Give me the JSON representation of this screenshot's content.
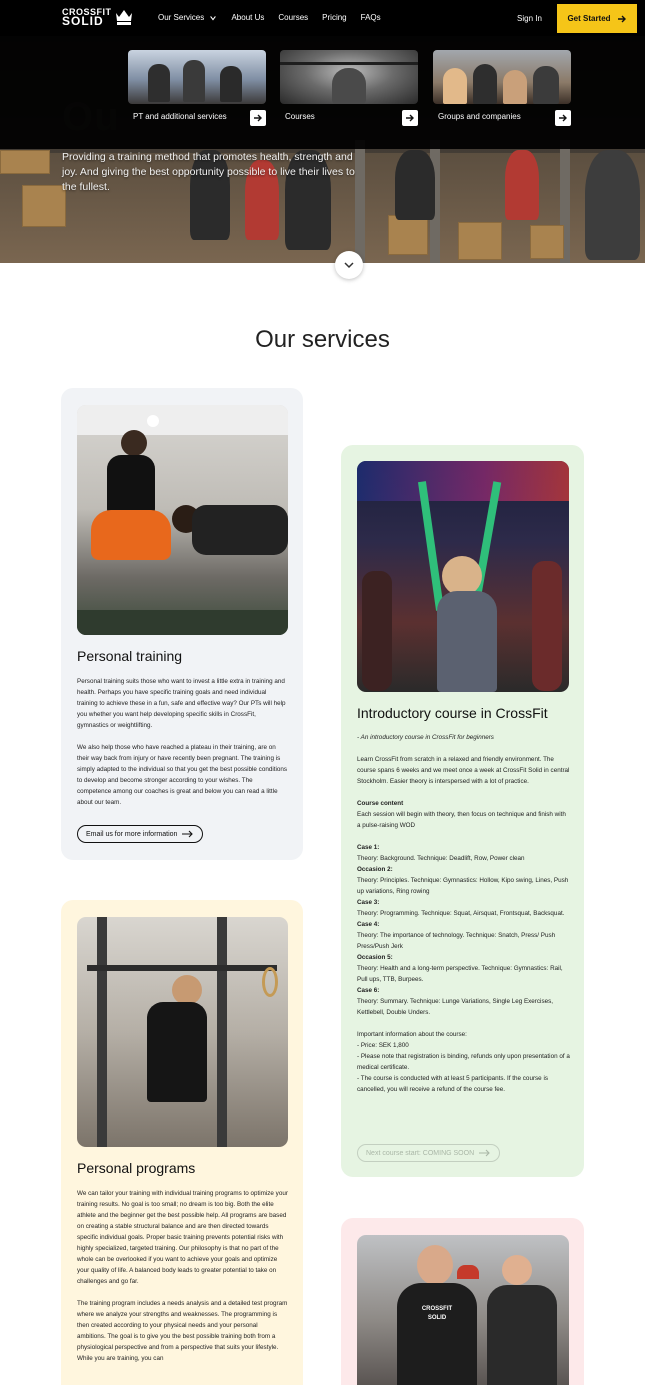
{
  "header": {
    "logo_line1": "CROSSFIT",
    "logo_line2": "SOLID",
    "nav": [
      "Our Services",
      "About Us",
      "Courses",
      "Pricing",
      "FAQs"
    ],
    "signin": "Sign In",
    "cta": "Get Started"
  },
  "mega_menu": [
    {
      "label": "PT and additional services"
    },
    {
      "label": "Courses"
    },
    {
      "label": "Groups and companies"
    }
  ],
  "hero": {
    "text": "Providing a training method that promotes health, strength and joy. And giving the best opportunity possible to live their lives to the fullest."
  },
  "main": {
    "section_title": "Our services"
  },
  "cards": {
    "personal_training": {
      "title": "Personal training",
      "p1": "Personal training suits those who want to invest a little extra in training and health. Perhaps you have specific training goals and need individual training to achieve these in a fun, safe and effective way? Our PTs will help you whether you want help developing specific skills in CrossFit, gymnastics or weightlifting.",
      "p2": "We also help those who have reached a plateau in their training, are on their way back from injury or have recently been pregnant. The training is simply adapted to the individual so that you get the best possible conditions to develop and become stronger according to your wishes. The competence among our coaches is great and below you can read a little about our team.",
      "button": "Email us for more information"
    },
    "intro_course": {
      "title": "Introductory course in CrossFit",
      "subtitle": "- An introductory course in CrossFit for beginners",
      "p1": "Learn CrossFit from scratch in a relaxed and friendly environment. The course spans 6 weeks and we meet once a week at CrossFit Solid in central Stockholm. Easier theory is interspersed with a lot of practice.",
      "content_heading": "Course content",
      "content_text": "Each session will begin with theory, then focus on technique and finish with a pulse-raising WOD",
      "sessions": [
        {
          "label": "Case 1:",
          "text": "Theory: Background. Technique: Deadlift, Row, Power clean"
        },
        {
          "label": "Occasion 2:",
          "text": "Theory: Principles. Technique: Gymnastics: Hollow, Kipo swing, Lines, Push up variations, Ring rowing"
        },
        {
          "label": "Case 3:",
          "text": "Theory: Programming. Technique: Squat, Airsquat, Frontsquat, Backsquat."
        },
        {
          "label": "Case 4:",
          "text": "Theory: The importance of technology. Technique: Snatch, Press/ Push Press/Push Jerk"
        },
        {
          "label": "Occasion 5:",
          "text": "Theory: Health and a long-term perspective. Technique: Gymnastics: Rail, Pull ups, TTB, Burpees."
        },
        {
          "label": "Case 6:",
          "text": "Theory: Summary. Technique: Lunge Variations, Single Leg Exercises, Kettlebell, Double Unders."
        }
      ],
      "info_heading": "Important information about the course:",
      "info_lines": [
        "- Price: SEK 1,800",
        "- Please note that registration is binding, refunds only upon presentation of a medical certificate.",
        "- The course is conducted with at least 5 participants. If the course is cancelled, you will receive a refund of the course fee."
      ],
      "button": "Next course start: COMING SOON"
    },
    "personal_programs": {
      "title": "Personal programs",
      "p1": "We can tailor your training with individual training programs to optimize your training results. No goal is too small; no dream is too big. Both the elite athlete and the beginner get the best possible help. All programs are based on creating a stable structural balance and are then directed towards specific individual goals. Proper basic training prevents potential risks with highly specialized, targeted training. Our philosophy is that no part of the whole can be overlooked if you want to achieve your goals and optimize your quality of life. A balanced body leads to greater potential to take on challenges and go far.",
      "p2": "The training program includes a needs analysis and a detailed test program where we analyze your strengths and weaknesses. The programming is then created according to your physical needs and your personal ambitions. The goal is to give you the best possible training both from a physiological perspective and from a perspective that suits your lifestyle. While you are training, you can"
    }
  },
  "colors": {
    "accent": "#f5c518",
    "card_gray": "#f1f3f6",
    "card_green": "#e6f4e2",
    "card_yellow": "#fff6de",
    "card_pink": "#fde9ea"
  }
}
